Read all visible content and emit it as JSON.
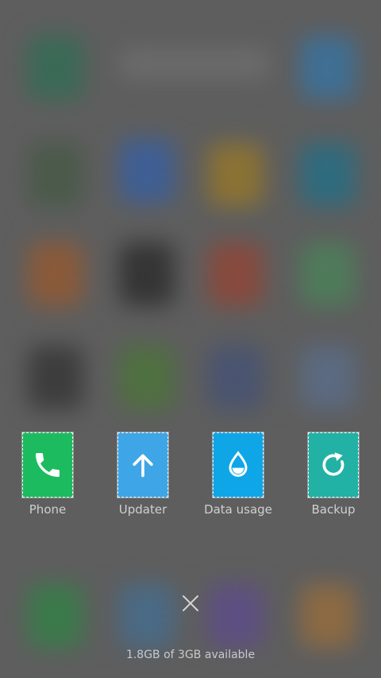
{
  "recent_apps": [
    {
      "label": "Phone",
      "icon": "phone-icon",
      "color": "#1dbb5f"
    },
    {
      "label": "Updater",
      "icon": "arrow-up-icon",
      "color": "#3ea6e6"
    },
    {
      "label": "Data usage",
      "icon": "water-drop-icon",
      "color": "#0fa6e8"
    },
    {
      "label": "Backup",
      "icon": "refresh-icon",
      "color": "#22b1a5"
    }
  ],
  "close_icon": "close-icon",
  "memory_status": "1.8GB of 3GB available",
  "colors": {
    "overlay": "#5e5e5e",
    "label_text": "#cfcfcf",
    "close": "#d4d4d4"
  }
}
